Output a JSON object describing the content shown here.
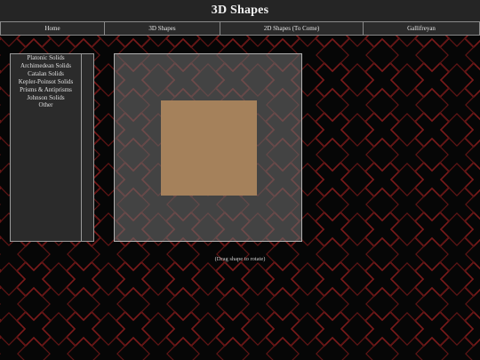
{
  "header": {
    "title": "3D Shapes"
  },
  "nav": {
    "tabs": [
      {
        "label": "Home"
      },
      {
        "label": "3D Shapes"
      },
      {
        "label": "2D Shapes (To Come)"
      },
      {
        "label": "Gallifreyan"
      }
    ]
  },
  "sidebar": {
    "items": [
      {
        "label": "Platonic Solids"
      },
      {
        "label": "Archimedean Solids"
      },
      {
        "label": "Catalan Solids"
      },
      {
        "label": "Kepler-Poinsot Solids"
      },
      {
        "label": "Prisms & Antiprisms"
      },
      {
        "label": "Johnson Solids"
      },
      {
        "label": "Other"
      }
    ]
  },
  "viewer": {
    "caption": "(Drag shape to rotate)"
  },
  "colors": {
    "background": "#060606",
    "pattern_stroke": "#7a1a1a",
    "panel": "#2b2b2b",
    "shape_fill": "#a5815b"
  }
}
